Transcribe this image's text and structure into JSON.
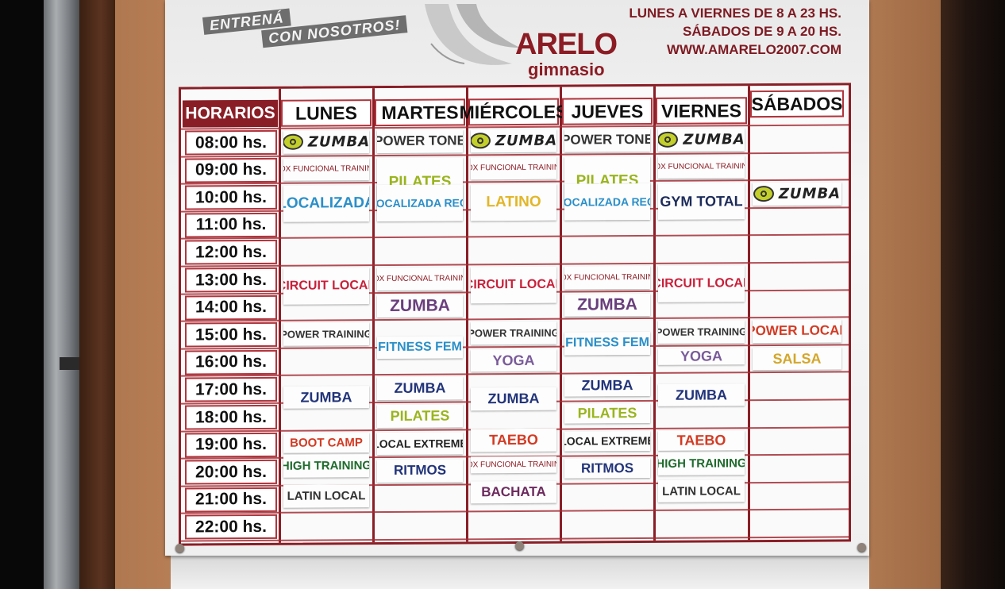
{
  "slogan": {
    "line1": "ENTRENÁ",
    "line2": "CON NOSOTROS!"
  },
  "logo": {
    "name": "ARELO",
    "subtitle": "gimnasio"
  },
  "info": {
    "weekday_hours": "LUNES A VIERNES DE 8  A 23 HS.",
    "saturday_hours": "SÁBADOS DE 9 A 20 HS.",
    "website": "WWW.AMARELO2007.COM"
  },
  "schedule": {
    "header_label": "HORARIOS",
    "days": [
      "LUNES",
      "MARTES",
      "MIÉRCOLES",
      "JUEVES",
      "VIERNES",
      "SÁBADOS"
    ],
    "times": [
      "08:00 hs.",
      "09:00 hs.",
      "10:00 hs.",
      "11:00 hs.",
      "12:00 hs.",
      "13:00 hs.",
      "14:00 hs.",
      "15:00 hs.",
      "16:00 hs.",
      "17:00 hs.",
      "18:00 hs.",
      "19:00 hs.",
      "20:00 hs.",
      "21:00 hs.",
      "22:00 hs."
    ],
    "classes": {
      "zumba_logo": "ZUMBA",
      "power_tone": "POWER TONE",
      "box_funcional": "BOX FUNCIONAL TRAINING",
      "pilates": "PILATES",
      "localizada": "LOCALIZADA",
      "localizada_rec": "LOCALIZADA REC.",
      "latino": "LATINO",
      "gym_total": "GYM TOTAL",
      "circuit_local": "CIRCUIT LOCAL",
      "zumba": "ZUMBA",
      "power_training": "POWER TRAINING",
      "fitness_fem": "FITNESS FEM",
      "yoga": "YOGA",
      "power_local": "POWER LOCAL",
      "salsa": "SALSA",
      "boot_camp": "BOOT CAMP",
      "taebo": "TAEBO",
      "local_extreme": "LOCAL EXTREME",
      "high_training": "HIGH TRAINING",
      "ritmos": "RITMOS",
      "latin_local": "LATIN LOCAL",
      "bachata": "BACHATA"
    }
  },
  "colors": {
    "brand": "#8c1c24",
    "zumba_green": "#c3cf2a",
    "localizada_blue": "#2a8fc9",
    "pilates_green": "#9ab41e",
    "latino_yellow": "#e2b62a",
    "circuit_red": "#c8203a",
    "zumba_purple": "#6a3f7c",
    "zumba_navy": "#22347a",
    "taebo_red": "#d33b24",
    "high_green": "#1f6b2d",
    "salsa_yellow": "#d4a62a",
    "yoga_purple": "#7a5b9a",
    "bachata_purple": "#6c2a5e"
  }
}
